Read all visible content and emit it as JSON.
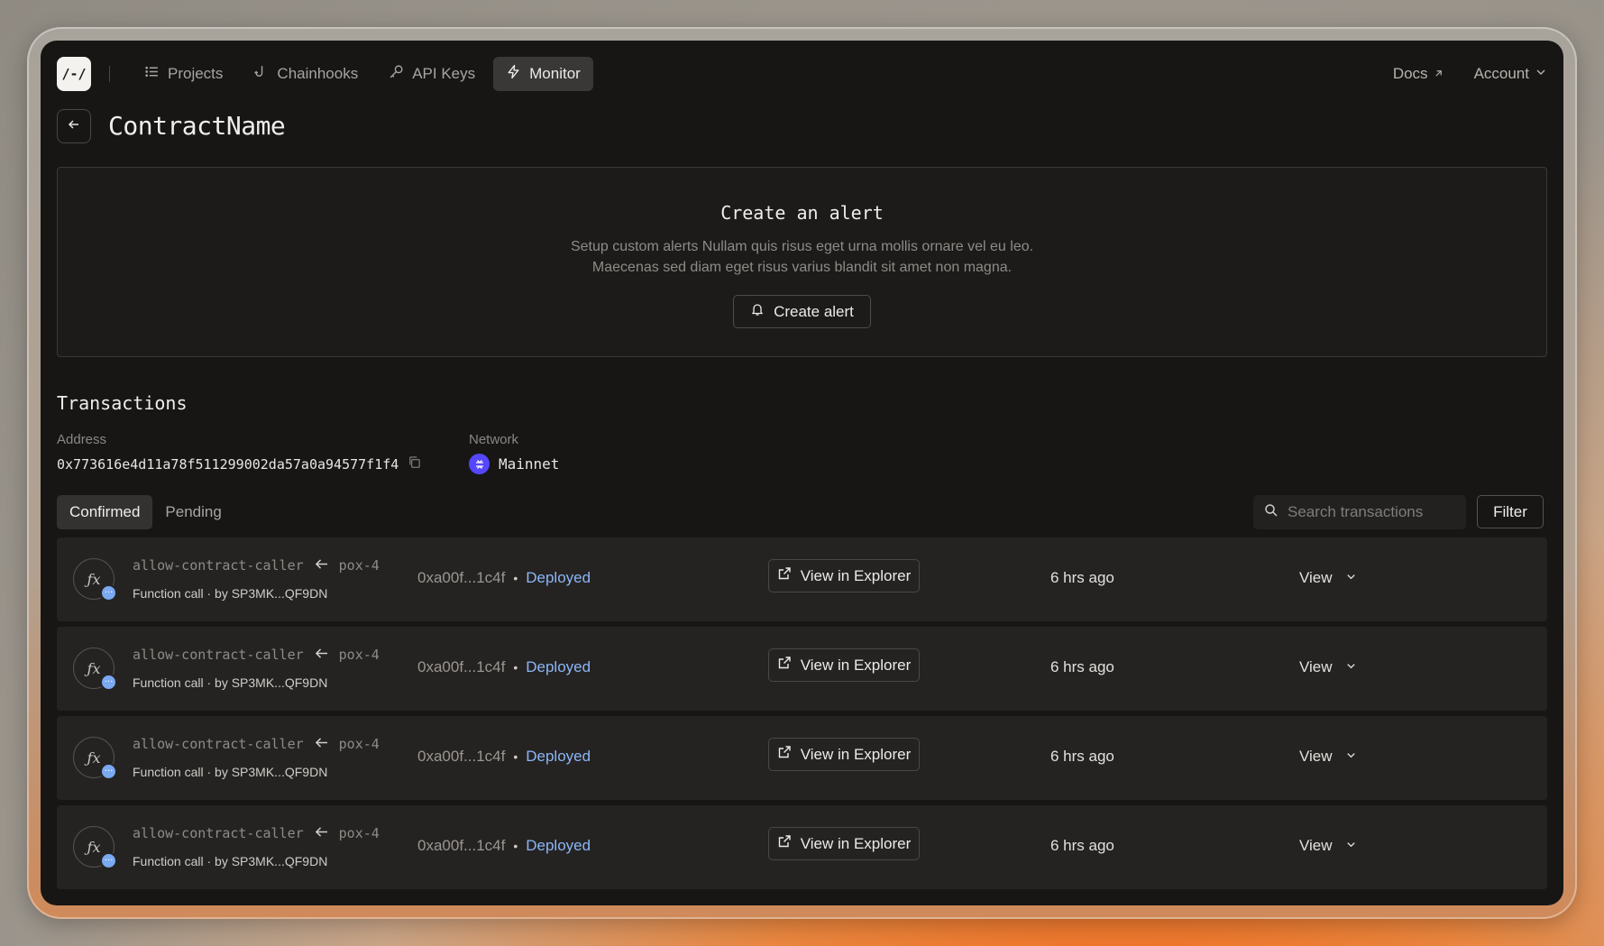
{
  "nav": {
    "logo_text": "/-/",
    "items": [
      {
        "label": "Projects",
        "icon": "list-icon"
      },
      {
        "label": "Chainhooks",
        "icon": "hook-icon"
      },
      {
        "label": "API Keys",
        "icon": "key-icon"
      },
      {
        "label": "Monitor",
        "icon": "bolt-icon",
        "active": true
      }
    ],
    "docs_label": "Docs",
    "account_label": "Account"
  },
  "page": {
    "title": "ContractName"
  },
  "alert": {
    "title": "Create an alert",
    "desc_line1": "Setup custom alerts Nullam quis risus eget urna mollis ornare vel eu leo.",
    "desc_line2": "Maecenas sed diam eget risus varius blandit sit amet non magna.",
    "button_label": "Create alert"
  },
  "transactions": {
    "title": "Transactions",
    "address_label": "Address",
    "address_value": "0x773616e4d11a78f511299002da57a0a94577f1f4",
    "network_label": "Network",
    "network_value": "Mainnet",
    "tabs": [
      "Confirmed",
      "Pending"
    ],
    "active_tab": "Confirmed",
    "search_placeholder": "Search transactions",
    "filter_label": "Filter",
    "rows": [
      {
        "function": "allow-contract-caller",
        "contract": "pox-4",
        "type": "Function call",
        "by": "by SP3MK...QF9DN",
        "hash": "0xa00f...1c4f",
        "status": "Deployed",
        "explorer_label": "View in Explorer",
        "time": "6 hrs ago",
        "view_label": "View"
      },
      {
        "function": "allow-contract-caller",
        "contract": "pox-4",
        "type": "Function call",
        "by": "by SP3MK...QF9DN",
        "hash": "0xa00f...1c4f",
        "status": "Deployed",
        "explorer_label": "View in Explorer",
        "time": "6 hrs ago",
        "view_label": "View"
      },
      {
        "function": "allow-contract-caller",
        "contract": "pox-4",
        "type": "Function call",
        "by": "by SP3MK...QF9DN",
        "hash": "0xa00f...1c4f",
        "status": "Deployed",
        "explorer_label": "View in Explorer",
        "time": "6 hrs ago",
        "view_label": "View"
      },
      {
        "function": "allow-contract-caller",
        "contract": "pox-4",
        "type": "Function call",
        "by": "by SP3MK...QF9DN",
        "hash": "0xa00f...1c4f",
        "status": "Deployed",
        "explorer_label": "View in Explorer",
        "time": "6 hrs ago",
        "view_label": "View"
      }
    ]
  },
  "colors": {
    "background": "#171615",
    "accent_status": "#8bb6f6",
    "network_dot": "#5546ff"
  }
}
